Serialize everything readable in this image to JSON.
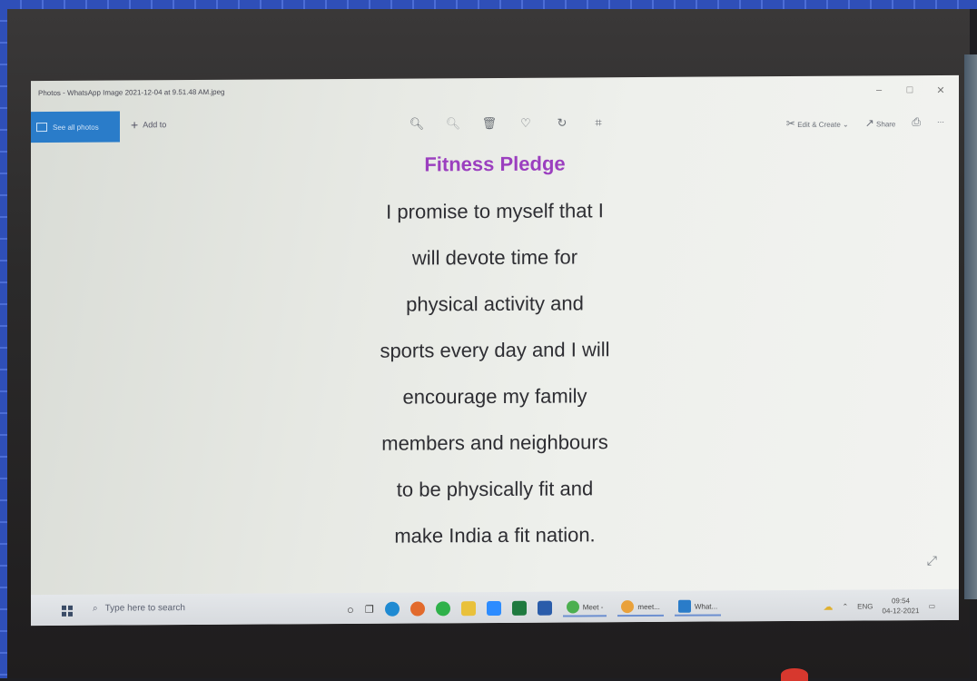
{
  "window": {
    "title": "Photos - WhatsApp Image 2021-12-04 at 9.51.48 AM.jpeg",
    "controls": [
      "–",
      "□",
      "✕"
    ]
  },
  "toolbar": {
    "see_all_label": "See all photos",
    "add_to_label": "Add to",
    "tool_icons": [
      "zoom-in-icon",
      "zoom-out-icon",
      "delete-icon",
      "favorite-icon",
      "rotate-icon",
      "crop-icon"
    ],
    "edit_create_label": "Edit & Create",
    "share_label": "Share"
  },
  "image": {
    "title": "Fitness Pledge",
    "lines": [
      "I promise to myself that I",
      "will devote time for",
      "physical activity and",
      "sports every day and I will",
      "encourage my family",
      "members and neighbours",
      "to be physically fit and",
      "make India a fit nation."
    ],
    "title_color": "#9b3fbf"
  },
  "taskbar": {
    "search_placeholder": "Type here to search",
    "apps": [
      {
        "label": "Meet -",
        "color": "#4caf50"
      },
      {
        "label": "meet...",
        "color": "#e9a13b"
      },
      {
        "label": "What...",
        "color": "#2a7cc9"
      }
    ],
    "language": "ENG",
    "time": "09:54",
    "date": "04-12-2021"
  }
}
